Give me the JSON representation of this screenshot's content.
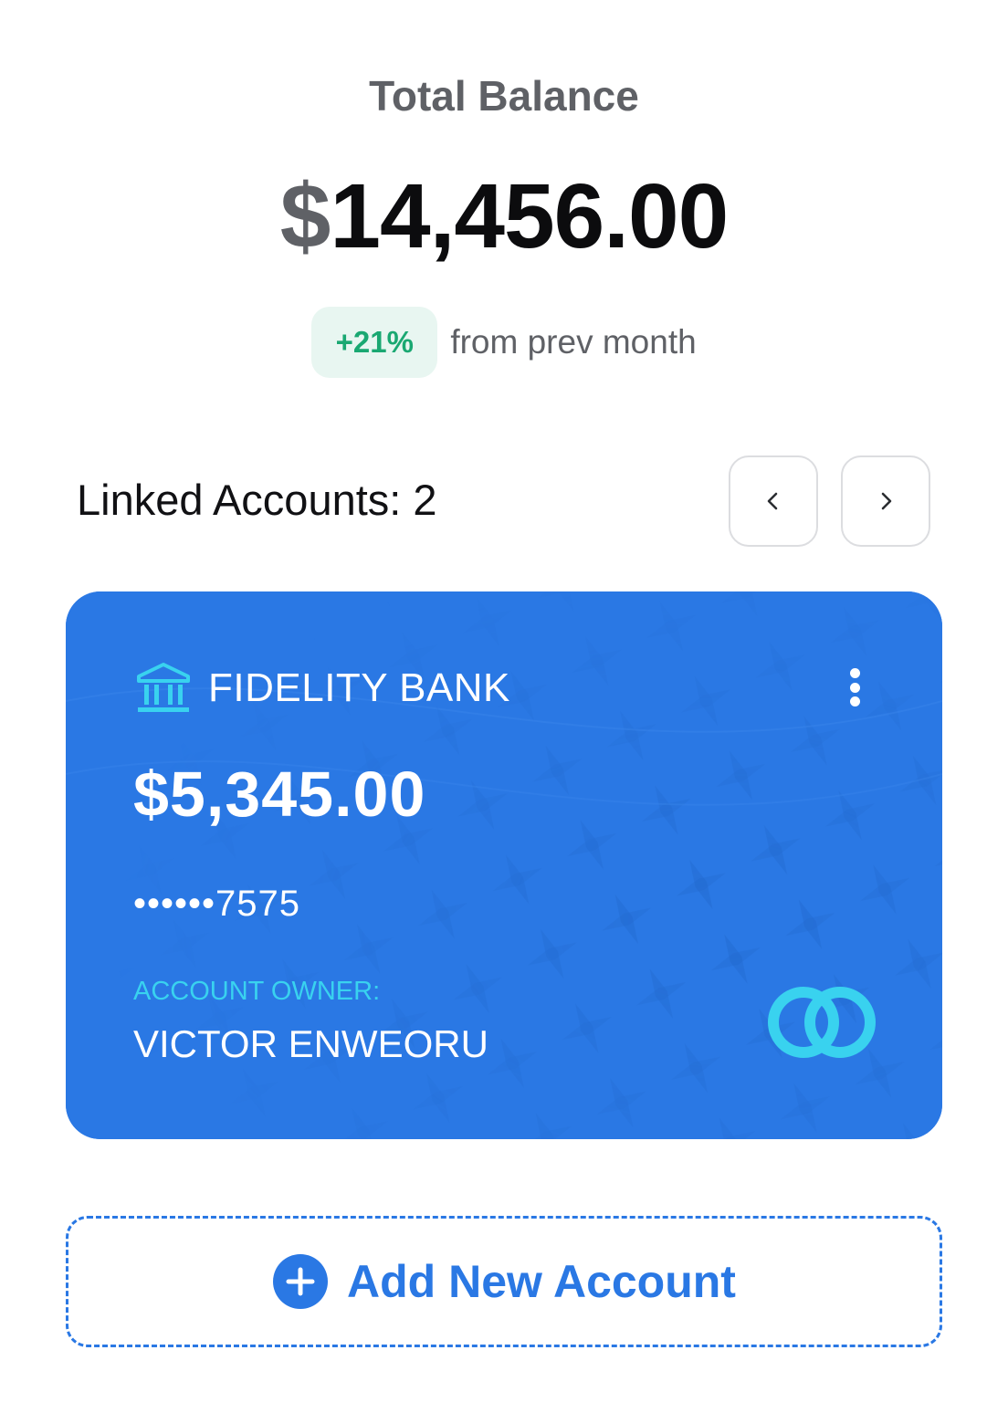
{
  "header": {
    "total_label": "Total Balance",
    "total_currency": "$",
    "total_amount": "14,456.00",
    "change_badge": "+21%",
    "change_text": "from prev month"
  },
  "linked": {
    "title": "Linked Accounts: 2",
    "prev_icon": "chevron-left-icon",
    "next_icon": "chevron-right-icon"
  },
  "card": {
    "bank_icon": "bank-icon",
    "bank_name": "FIDELITY BANK",
    "balance": "$5,345.00",
    "masked_number": "••••••7575",
    "owner_label": "ACCOUNT OWNER:",
    "owner_name": "VICTOR ENWEORU",
    "logo_icon": "card-network-logo-icon",
    "menu_icon": "more-vertical-icon"
  },
  "add_account": {
    "icon": "plus-circle-icon",
    "label": "Add New Account"
  },
  "colors": {
    "primary": "#2a78e4",
    "positive": "#1aa872",
    "positive_bg": "#e8f6f1",
    "accent_cyan": "#39d2ef",
    "muted_text": "#5f6166"
  }
}
